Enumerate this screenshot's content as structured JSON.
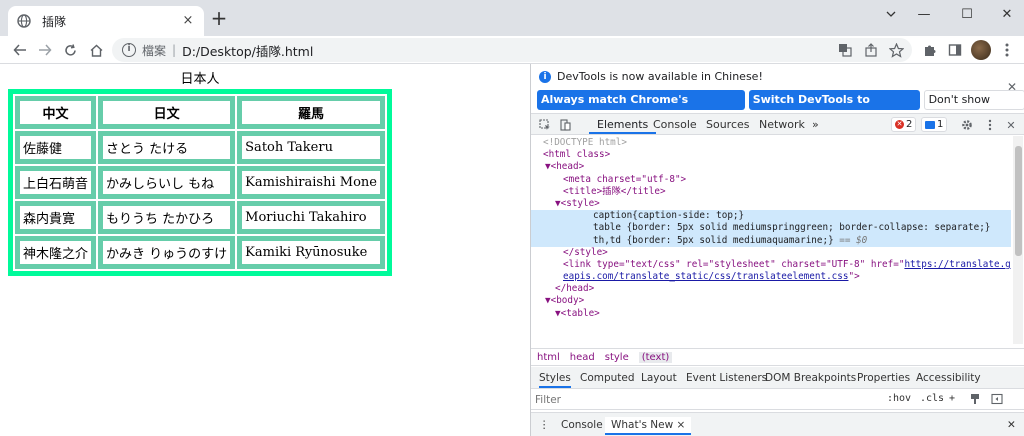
{
  "browser": {
    "tab_title": "插隊",
    "tab_close": "×",
    "new_tab": "+",
    "window_controls": [
      "—",
      "☐",
      "✕"
    ],
    "scheme_label": "檔案",
    "url": "D:/Desktop/插隊.html"
  },
  "page": {
    "caption": "日本人",
    "headers": [
      "中文",
      "日文",
      "羅馬"
    ],
    "rows": [
      [
        "佐藤健",
        "さとう たける",
        "Satoh Takeru"
      ],
      [
        "上白石萌音",
        "かみしらいし もね",
        "Kamishiraishi Mone"
      ],
      [
        "森内貴寛",
        "もりうち たかひろ",
        "Moriuchi Takahiro"
      ],
      [
        "神木隆之介",
        "かみき りゅうのすけ",
        "Kamiki Ryūnosuke"
      ]
    ],
    "colors": {
      "table_border": "#00fa9a",
      "cell_border": "#66cdaa"
    }
  },
  "devtools": {
    "infobar": {
      "message": "DevTools is now available in Chinese!",
      "btn_match": "Always match Chrome's language",
      "btn_switch": "Switch DevTools to Chinese",
      "btn_dismiss": "Don't show again"
    },
    "tabs": [
      "Elements",
      "Console",
      "Sources",
      "Network",
      "»"
    ],
    "error_count": "2",
    "message_count": "1",
    "dom_lines": [
      "<!DOCTYPE html>",
      "<html class>",
      "▼<head>",
      "<meta charset=\"utf-8\">",
      "<title>插隊</title>",
      "▼<style>",
      "caption{caption-side: top;}",
      "table {border: 5px solid mediumspringgreen; border-collapse: separate;}",
      "th,td {border: 5px solid mediumaquamarine;}",
      "== $0",
      "</style>",
      "<link type=\"text/css\" rel=\"stylesheet\" charset=\"UTF-8\" href=\"",
      "https://translate.googl",
      "eapis.com/translate_static/css/translateelement.css",
      "\">",
      "</head>",
      "▼<body>",
      "▼<table>"
    ],
    "breadcrumbs": [
      "html",
      "head",
      "style",
      "(text)"
    ],
    "subtabs": [
      "Styles",
      "Computed",
      "Layout",
      "Event Listeners",
      "DOM Breakpoints",
      "Properties",
      "Accessibility"
    ],
    "filter_placeholder": "Filter",
    "filter_hov": ":hov",
    "filter_cls": ".cls",
    "drawer_tabs": [
      "Console",
      "What's New"
    ],
    "drawer_close": "×"
  }
}
